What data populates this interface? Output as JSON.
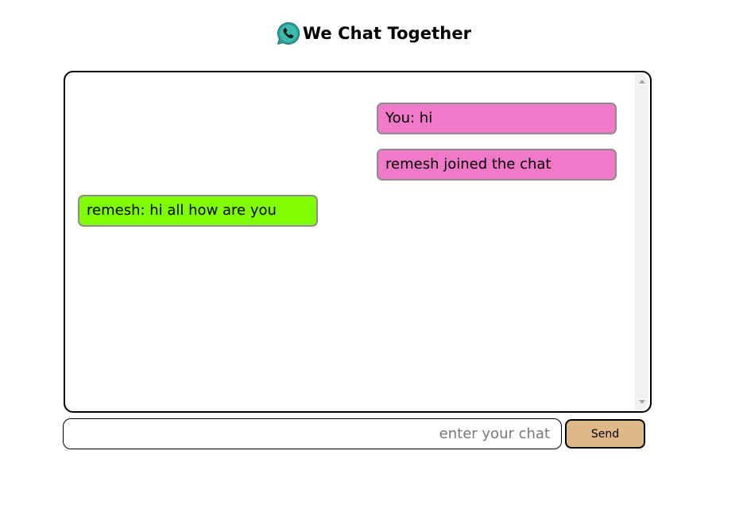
{
  "header": {
    "title": "We Chat Together",
    "logo_icon": "whatsapp-icon"
  },
  "chat": {
    "messages": [
      {
        "text": "You: hi",
        "side": "right",
        "color": "#f07ac8"
      },
      {
        "text": "remesh joined the chat",
        "side": "right",
        "color": "#f07ac8"
      },
      {
        "text": "remesh: hi all how are you",
        "side": "left",
        "color": "#80ff00"
      }
    ]
  },
  "composer": {
    "placeholder": "enter your chat",
    "value": "",
    "send_label": "Send",
    "send_color": "#deb887"
  }
}
